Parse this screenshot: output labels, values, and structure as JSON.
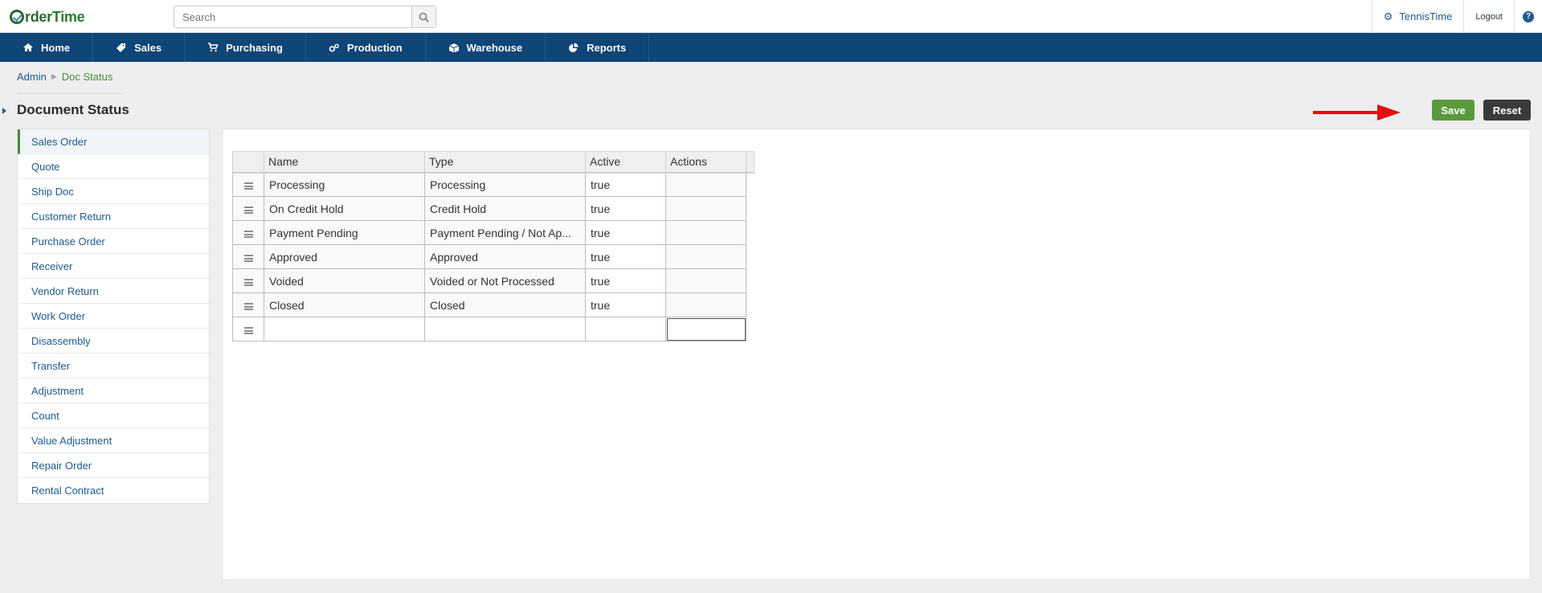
{
  "app": {
    "logo_first": "rder",
    "logo_second": "Time"
  },
  "search": {
    "placeholder": "Search",
    "value": "",
    "icon": "search-icon"
  },
  "top_right": {
    "company": "TennisTime",
    "logout": "Logout",
    "help_icon": "?"
  },
  "nav": {
    "items": [
      {
        "label": "Home",
        "icon": "home-icon"
      },
      {
        "label": "Sales",
        "icon": "tag-icon"
      },
      {
        "label": "Purchasing",
        "icon": "cart-icon"
      },
      {
        "label": "Production",
        "icon": "gears-icon"
      },
      {
        "label": "Warehouse",
        "icon": "cube-icon"
      },
      {
        "label": "Reports",
        "icon": "pie-chart-icon"
      }
    ]
  },
  "breadcrumb": {
    "parent": "Admin",
    "current": "Doc Status"
  },
  "page": {
    "title": "Document Status",
    "save_label": "Save",
    "reset_label": "Reset"
  },
  "doc_types": [
    "Sales Order",
    "Quote",
    "Ship Doc",
    "Customer Return",
    "Purchase Order",
    "Receiver",
    "Vendor Return",
    "Work Order",
    "Disassembly",
    "Transfer",
    "Adjustment",
    "Count",
    "Value Adjustment",
    "Repair Order",
    "Rental Contract"
  ],
  "selected_doc_type": "Sales Order",
  "grid": {
    "columns": [
      "Name",
      "Type",
      "Active",
      "Actions"
    ],
    "rows": [
      {
        "name": "Processing",
        "type": "Processing",
        "active": "true",
        "actions": ""
      },
      {
        "name": "On Credit Hold",
        "type": "Credit Hold",
        "active": "true",
        "actions": ""
      },
      {
        "name": "Payment Pending",
        "type": "Payment Pending / Not Ap...",
        "active": "true",
        "actions": ""
      },
      {
        "name": "Approved",
        "type": "Approved",
        "active": "true",
        "actions": ""
      },
      {
        "name": "Voided",
        "type": "Voided or Not Processed",
        "active": "true",
        "actions": ""
      },
      {
        "name": "Closed",
        "type": "Closed",
        "active": "true",
        "actions": ""
      }
    ]
  },
  "colors": {
    "nav_bg": "#0f4577",
    "save_bg": "#5b9a3c",
    "reset_bg": "#3a3a3a",
    "link": "#1f5a8c",
    "annotation_arrow": "#e01010"
  }
}
